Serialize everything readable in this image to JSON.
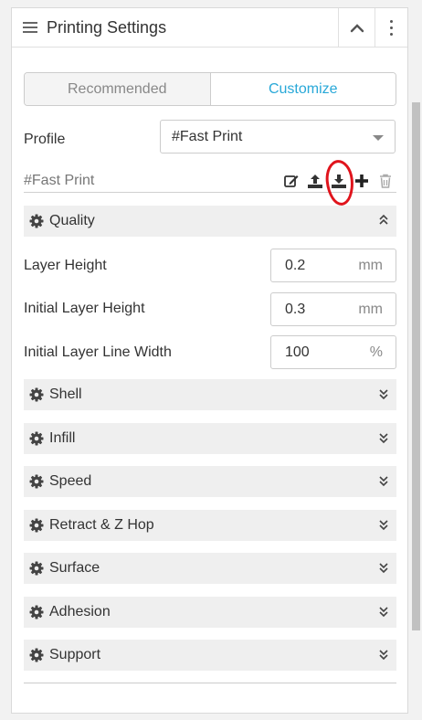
{
  "header": {
    "title": "Printing Settings"
  },
  "mode_tabs": [
    {
      "label": "Recommended",
      "active": false
    },
    {
      "label": "Customize",
      "active": true
    }
  ],
  "profile": {
    "label": "Profile",
    "selected": "#Fast Print",
    "current_name": "#Fast Print",
    "actions": [
      "edit-icon",
      "upload-icon",
      "download-icon",
      "plus-icon",
      "trash-icon"
    ]
  },
  "sections": {
    "quality": {
      "title": "Quality",
      "expanded": true,
      "fields": [
        {
          "label": "Layer Height",
          "value": "0.2",
          "unit": "mm"
        },
        {
          "label": "Initial Layer Height",
          "value": "0.3",
          "unit": "mm"
        },
        {
          "label": "Initial Layer Line Width",
          "value": "100",
          "unit": "%"
        }
      ]
    },
    "collapsed": [
      {
        "title": "Shell"
      },
      {
        "title": "Infill"
      },
      {
        "title": "Speed"
      },
      {
        "title": "Retract & Z Hop"
      },
      {
        "title": "Surface"
      },
      {
        "title": "Adhesion"
      },
      {
        "title": "Support"
      }
    ]
  },
  "colors": {
    "accent": "#28a8d8",
    "highlight": "#e0141c",
    "section_bg": "#efefef"
  }
}
